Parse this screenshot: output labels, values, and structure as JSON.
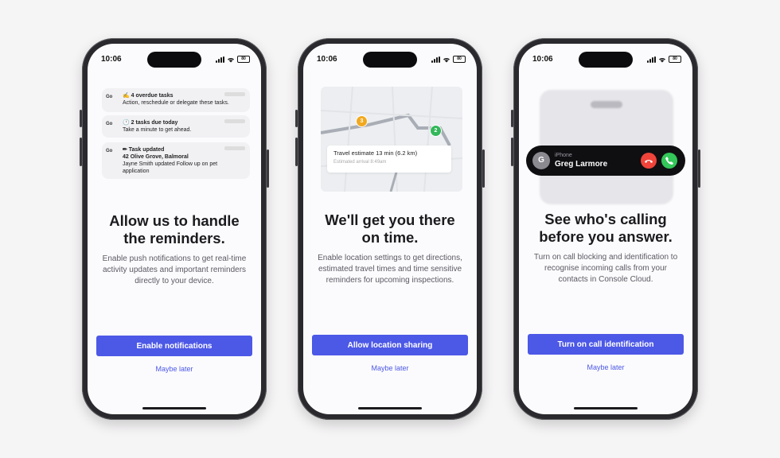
{
  "status_bar": {
    "time": "10:06",
    "battery": "80"
  },
  "phones": [
    {
      "heading_1": "Allow us to handle",
      "heading_2": "the reminders.",
      "body_1": "Enable push notifications to get real-time",
      "body_2": "activity updates and important reminders",
      "body_3": "directly to your device.",
      "cta": "Enable notifications",
      "later": "Maybe later",
      "notifications": [
        {
          "app": "Go",
          "title": "✍ 4 overdue tasks",
          "line1": "Action, reschedule or delegate these tasks."
        },
        {
          "app": "Go",
          "title": "🕐 2 tasks due today",
          "line1": "Take a minute to get ahead."
        },
        {
          "app": "Go",
          "title": "✏ Task updated",
          "line1": "42 Olive Grove, Balmoral",
          "line2": "Jayne Smith updated Follow up on pet",
          "line3": "application"
        }
      ]
    },
    {
      "heading_1": "We'll get you there",
      "heading_2": "on time.",
      "body_1": "Enable location settings to get directions,",
      "body_2": "estimated travel times and time sensitive",
      "body_3": "reminders for upcoming inspections.",
      "cta": "Allow location sharing",
      "later": "Maybe later",
      "map": {
        "trip": "Travel estimate 13 min (6.2 km)",
        "arrival": "Estimated arrival 8:49am",
        "pin_a": "3",
        "pin_b": "2"
      }
    },
    {
      "heading_1": "See who's calling",
      "heading_2": "before you answer.",
      "body_1": "Turn on call blocking and identification to",
      "body_2": "recognise incoming calls from your",
      "body_3": "contacts in Console Cloud.",
      "cta": "Turn on call identification",
      "later": "Maybe later",
      "call": {
        "avatar": "G",
        "kind": "iPhone",
        "name": "Greg Larmore"
      }
    }
  ],
  "colors": {
    "accent": "#4c58e6",
    "decline": "#f0443a",
    "accept": "#34c759",
    "frame": "#2a2a2e"
  }
}
